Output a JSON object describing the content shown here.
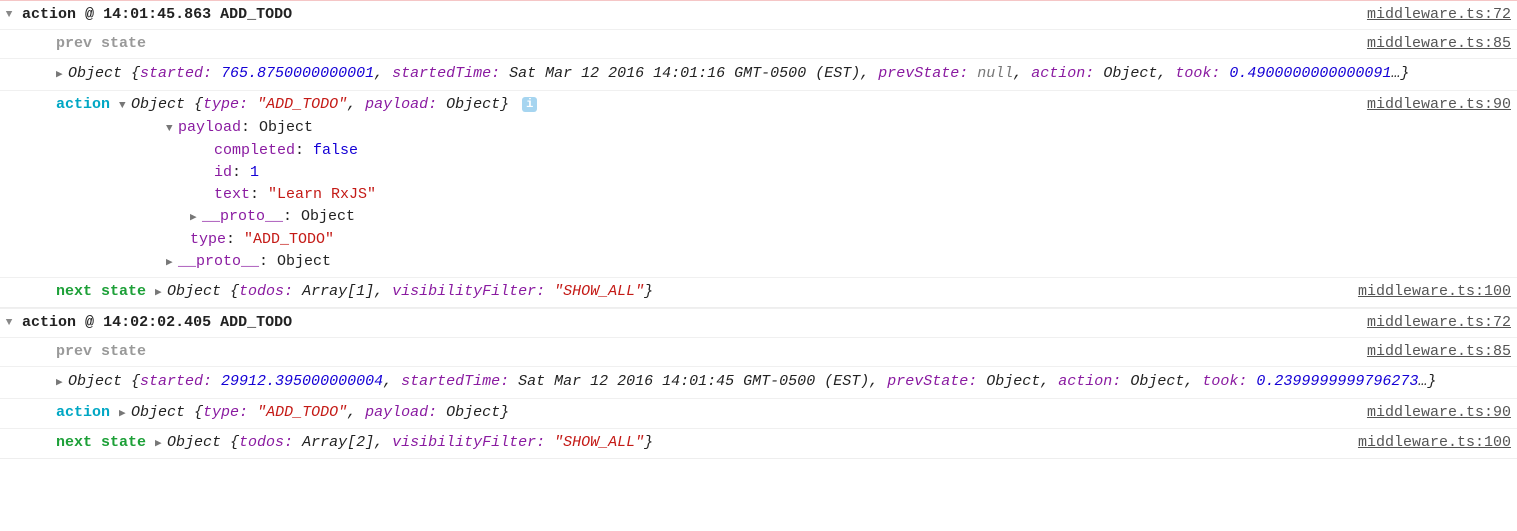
{
  "groups": [
    {
      "header": {
        "label": "action",
        "at": "@",
        "time": "14:01:45.863",
        "action": "ADD_TODO",
        "src": "middleware.ts:72"
      },
      "prev": {
        "label": "prev state",
        "src": "middleware.ts:85",
        "obj_prefix": "Object {",
        "started_key": "started:",
        "started_val": "765.8750000000001",
        "sep": ", ",
        "startedTime_key": "startedTime:",
        "startedTime_val": "Sat Mar 12 2016 14:01:16 GMT-0500 (EST)",
        "prevState_key": "prevState:",
        "prevState_val": "null",
        "action_key": "action:",
        "action_val": "Object",
        "took_key": "took:",
        "took_val": "0.4900000000000091",
        "suffix": "…}"
      },
      "action": {
        "label": "action",
        "src": "middleware.ts:90",
        "obj_prefix": "Object {",
        "type_key": "type:",
        "type_val": "\"ADD_TODO\"",
        "payload_key": "payload:",
        "payload_val": "Object",
        "suffix": "}",
        "expanded": true,
        "tree": {
          "payload_key": "payload",
          "payload_type": "Object",
          "completed_key": "completed",
          "completed_val": "false",
          "id_key": "id",
          "id_val": "1",
          "text_key": "text",
          "text_val": "\"Learn RxJS\"",
          "proto_key": "__proto__",
          "proto_val": "Object",
          "type_key": "type",
          "type_val": "\"ADD_TODO\""
        }
      },
      "next": {
        "label": "next state",
        "src": "middleware.ts:100",
        "obj_prefix": "Object {",
        "todos_key": "todos:",
        "todos_val": "Array[1]",
        "vf_key": "visibilityFilter:",
        "vf_val": "\"SHOW_ALL\"",
        "suffix": "}"
      }
    },
    {
      "header": {
        "label": "action",
        "at": "@",
        "time": "14:02:02.405",
        "action": "ADD_TODO",
        "src": "middleware.ts:72"
      },
      "prev": {
        "label": "prev state",
        "src": "middleware.ts:85",
        "obj_prefix": "Object {",
        "started_key": "started:",
        "started_val": "29912.395000000004",
        "sep": ", ",
        "startedTime_key": "startedTime:",
        "startedTime_val": "Sat Mar 12 2016 14:01:45 GMT-0500 (EST)",
        "prevState_key": "prevState:",
        "prevState_val": "Object",
        "action_key": "action:",
        "action_val": "Object",
        "took_key": "took:",
        "took_val": "0.2399999999796273",
        "suffix": "…}"
      },
      "action": {
        "label": "action",
        "src": "middleware.ts:90",
        "obj_prefix": "Object {",
        "type_key": "type:",
        "type_val": "\"ADD_TODO\"",
        "payload_key": "payload:",
        "payload_val": "Object",
        "suffix": "}",
        "expanded": false
      },
      "next": {
        "label": "next state",
        "src": "middleware.ts:100",
        "obj_prefix": "Object {",
        "todos_key": "todos:",
        "todos_val": "Array[2]",
        "vf_key": "visibilityFilter:",
        "vf_val": "\"SHOW_ALL\"",
        "suffix": "}"
      }
    }
  ]
}
